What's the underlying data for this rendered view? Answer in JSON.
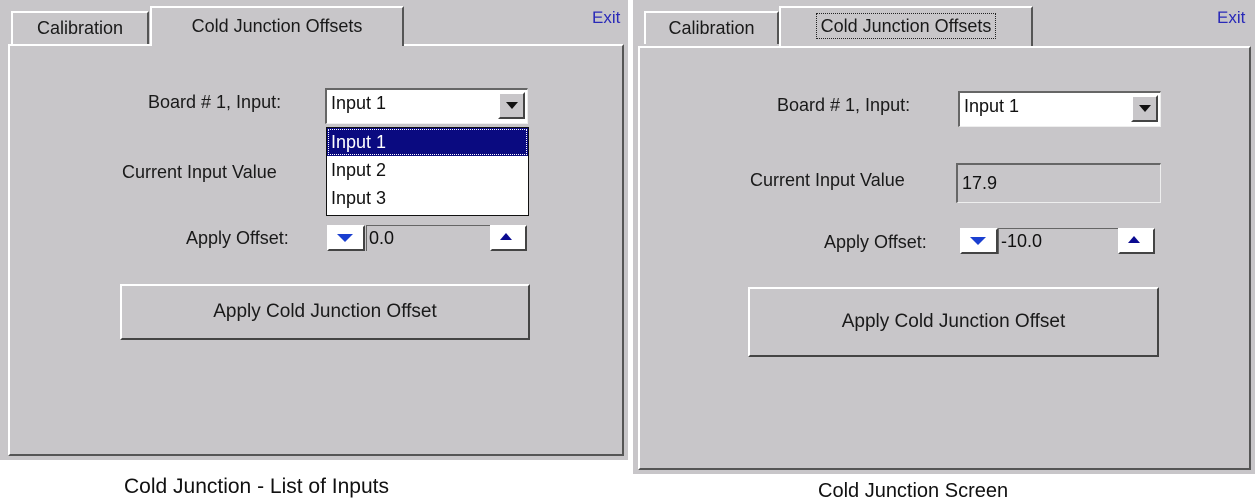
{
  "screen1": {
    "tabs": [
      "Calibration",
      "Cold Junction Offsets"
    ],
    "exit_label": "Exit",
    "board_label": "Board # 1, Input:",
    "selected_input": "Input 1",
    "dropdown_options": [
      "Input 1",
      "Input 2",
      "Input 3"
    ],
    "current_value_label": "Current Input Value",
    "offset_label": "Apply Offset:",
    "offset_value": "0.0",
    "apply_button_label": "Apply Cold Junction Offset",
    "caption": "Cold Junction - List of Inputs"
  },
  "screen2": {
    "tabs": [
      "Calibration",
      "Cold Junction Offsets"
    ],
    "exit_label": "Exit",
    "board_label": "Board # 1, Input:",
    "selected_input": "Input 1",
    "current_value_label": "Current Input Value",
    "current_value": "17.9",
    "offset_label": "Apply Offset:",
    "offset_value": "-10.0",
    "apply_button_label": "Apply Cold Junction Offset",
    "caption": "Cold Junction Screen"
  },
  "icons": {
    "combo_arrow": "chevron-down-icon",
    "spin_down": "triangle-down-icon",
    "spin_up": "triangle-up-icon"
  },
  "colors": {
    "background": "#c8c6c9",
    "selection": "#0a0a80",
    "exit_link": "#2929b8",
    "spin_arrow": "#1a3fd0"
  }
}
